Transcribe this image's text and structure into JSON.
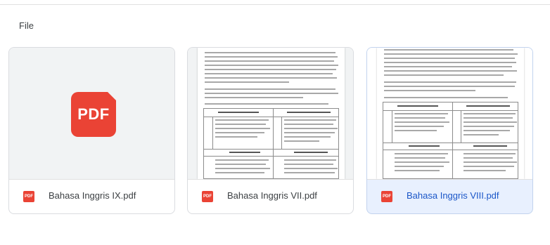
{
  "section": {
    "label": "File"
  },
  "icons": {
    "pdf_large": "PDF",
    "pdf_small": "PDF"
  },
  "files": [
    {
      "name": "Bahasa Inggris IX.pdf",
      "thumbnail": "pdf-icon-placeholder",
      "selected": false
    },
    {
      "name": "Bahasa Inggris VII.pdf",
      "thumbnail": "document-preview",
      "selected": false
    },
    {
      "name": "Bahasa Inggris VIII.pdf",
      "thumbnail": "document-preview",
      "selected": true
    }
  ],
  "colors": {
    "pdf_red": "#ea4335",
    "selected_bg": "#e8f0fe",
    "selected_text": "#1a56c8",
    "border": "#dadce0"
  }
}
